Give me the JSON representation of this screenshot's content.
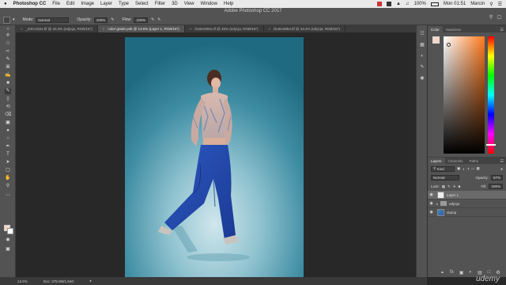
{
  "menubar": {
    "apple": "",
    "app_name": "Photoshop CC",
    "items": [
      "File",
      "Edit",
      "Image",
      "Layer",
      "Type",
      "Select",
      "Filter",
      "3D",
      "View",
      "Window",
      "Help"
    ],
    "battery": "100%",
    "clock": "Mon 01:51",
    "user": "Marcin"
  },
  "window_title": "Adobe Photoshop CC 2017",
  "options": {
    "mode_label": "Mode:",
    "mode_value": "Normal",
    "opacity_label": "Opacity:",
    "opacity_value": "100%",
    "flow_label": "Flow:",
    "flow_value": "100%"
  },
  "tabs": [
    {
      "label": "_DSC2324.tif @ 33.3% (edycja, RGB/16*)",
      "active": false
    },
    {
      "label": "color grade.psb @ 13.5% (Layer 1, RGB/16*)",
      "active": true
    },
    {
      "label": "DLBA0052.tif @ 25% (edycja, RGB/16*)",
      "active": false
    },
    {
      "label": "DLBA2854.tif @ 33.4% (edycja, RGB/16*)",
      "active": false
    }
  ],
  "status": {
    "zoom": "13.5%",
    "doc": "Doc: 378.0M/1.84G"
  },
  "color_panel": {
    "tabs": [
      "Color",
      "Swatches"
    ],
    "fg_color": "#f5d7c4"
  },
  "layers_panel": {
    "tabs": [
      "Layers",
      "Channels",
      "Paths"
    ],
    "filter_label": "Kind",
    "blend_mode": "Normal",
    "opacity_label": "Opacity:",
    "opacity_value": "67%",
    "lock_label": "Lock:",
    "fill_label": "Fill:",
    "fill_value": "100%",
    "layers": [
      {
        "name": "Layer 1",
        "active": true,
        "type": "pixel"
      },
      {
        "name": "edycja",
        "active": false,
        "type": "group"
      },
      {
        "name": "stamp",
        "active": false,
        "type": "photo"
      }
    ]
  },
  "watermark": "udemy",
  "colors": {
    "accent": "#2f6fd0",
    "chrome": "#535353",
    "workspace": "#282828"
  }
}
